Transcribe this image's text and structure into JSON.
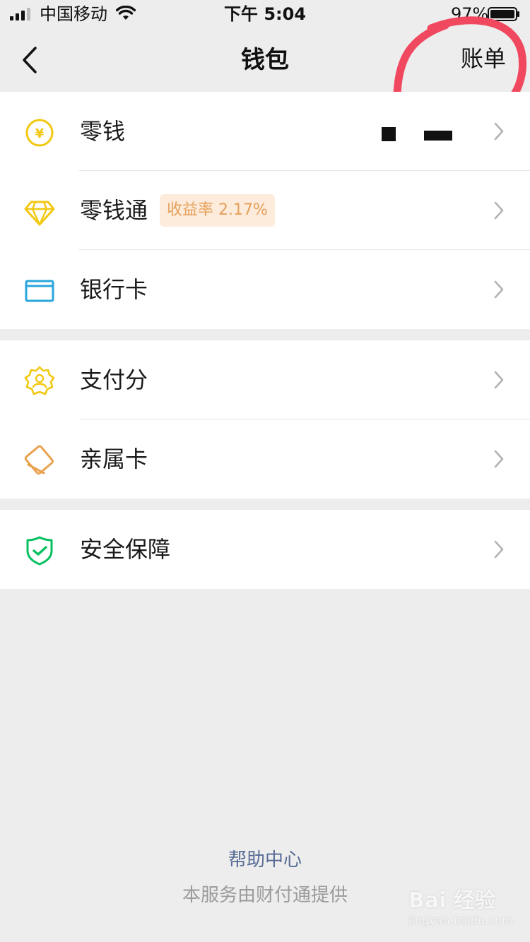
{
  "status_bar": {
    "carrier": "中国移动",
    "time": "下午 5:04",
    "battery": "97%"
  },
  "nav": {
    "title": "钱包",
    "bill": "账单"
  },
  "groups": [
    {
      "items": [
        {
          "label": "零钱",
          "icon": "yuan-coin-icon",
          "color": "#F2C811"
        },
        {
          "label": "零钱通",
          "icon": "diamond-icon",
          "color": "#F2C811",
          "badge": "收益率 2.17%"
        },
        {
          "label": "银行卡",
          "icon": "bank-card-icon",
          "color": "#2AA5DB"
        }
      ]
    },
    {
      "items": [
        {
          "label": "支付分",
          "icon": "pay-score-icon",
          "color": "#F2C811"
        },
        {
          "label": "亲属卡",
          "icon": "family-card-icon",
          "color": "#E9A24E"
        }
      ]
    },
    {
      "items": [
        {
          "label": "安全保障",
          "icon": "shield-icon",
          "color": "#07C160"
        }
      ]
    }
  ],
  "footer": {
    "help": "帮助中心",
    "note": "本服务由财付通提供"
  },
  "watermark": {
    "brand": "Bai 经验",
    "url": "jingyan.baidu.com"
  },
  "colors": {
    "background": "#EDEDED",
    "link": "#576B95",
    "annotation": "#F0485E"
  }
}
